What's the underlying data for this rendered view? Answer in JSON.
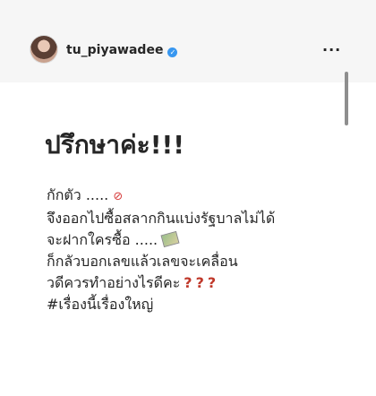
{
  "post": {
    "username": "tu_piyawadee",
    "verified_icon": "verified-badge-icon",
    "more_label": "···"
  },
  "content": {
    "title": "ปรึกษาค่ะ!!!",
    "lines": [
      "กักตัว ..... ",
      "จึงออกไปซื้อสลากกินแบ่งรัฐบาลไม่ได้",
      "จะฝากใครซื้อ ..... ",
      "ก็กลัวบอกเลขแล้วเลขจะเคลื่อน",
      "วดีควรทำอย่างไรดีคะ",
      "#เรื่องนี้เรื่องใหญ่"
    ],
    "question_marks": [
      "?",
      "?",
      "?"
    ]
  },
  "colors": {
    "accent": "#3897f0",
    "question": "#c0392b",
    "no_entry": "#d63b3b"
  }
}
